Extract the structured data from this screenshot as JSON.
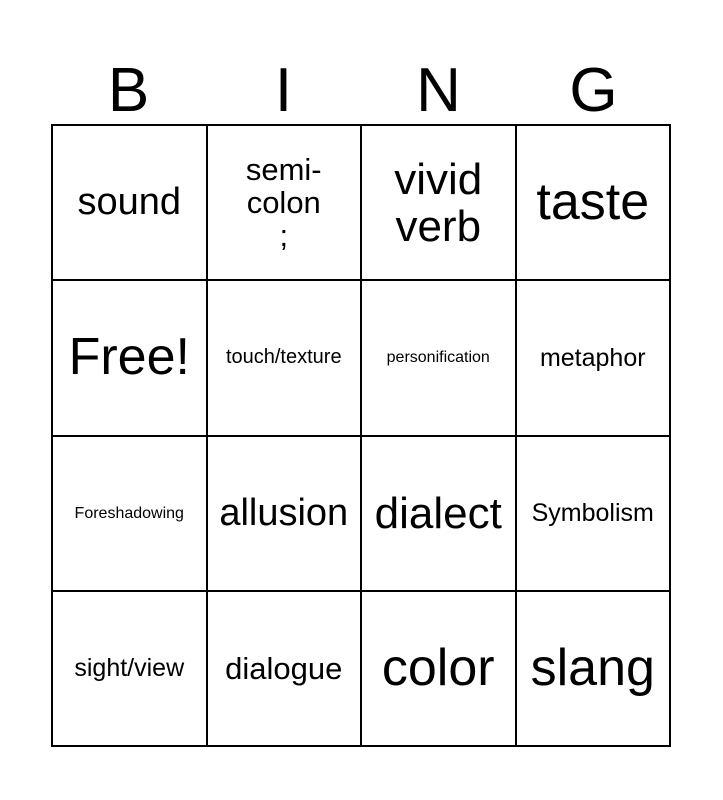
{
  "card": {
    "title": "BING",
    "header_letters": [
      "B",
      "I",
      "N",
      "G"
    ],
    "columns": 4,
    "rows": 4,
    "border_color": "#000000",
    "background_color": "#ffffff",
    "text_color": "#000000",
    "cells": [
      {
        "text": "sound",
        "size": "fs-l",
        "row": 1,
        "col": 1
      },
      {
        "text": "semi-colon\n;",
        "size": "fs-m",
        "row": 1,
        "col": 2
      },
      {
        "text": "vivid verb",
        "size": "fs-xl",
        "row": 1,
        "col": 3
      },
      {
        "text": "taste",
        "size": "fs-xxl",
        "row": 1,
        "col": 4
      },
      {
        "text": "Free!",
        "size": "fs-xxl",
        "row": 2,
        "col": 1
      },
      {
        "text": "touch/texture",
        "size": "fs-xs",
        "row": 2,
        "col": 2
      },
      {
        "text": "personification",
        "size": "fs-xxs",
        "row": 2,
        "col": 3
      },
      {
        "text": "metaphor",
        "size": "fs-s",
        "row": 2,
        "col": 4
      },
      {
        "text": "Foreshadowing",
        "size": "fs-xxs",
        "row": 3,
        "col": 1
      },
      {
        "text": "allusion",
        "size": "fs-l",
        "row": 3,
        "col": 2
      },
      {
        "text": "dialect",
        "size": "fs-xl",
        "row": 3,
        "col": 3
      },
      {
        "text": "Symbolism",
        "size": "fs-s",
        "row": 3,
        "col": 4
      },
      {
        "text": "sight/view",
        "size": "fs-s",
        "row": 4,
        "col": 1
      },
      {
        "text": "dialogue",
        "size": "fs-m",
        "row": 4,
        "col": 2
      },
      {
        "text": "color",
        "size": "fs-xxl",
        "row": 4,
        "col": 3
      },
      {
        "text": "slang",
        "size": "fs-xxl",
        "row": 4,
        "col": 4
      }
    ]
  }
}
